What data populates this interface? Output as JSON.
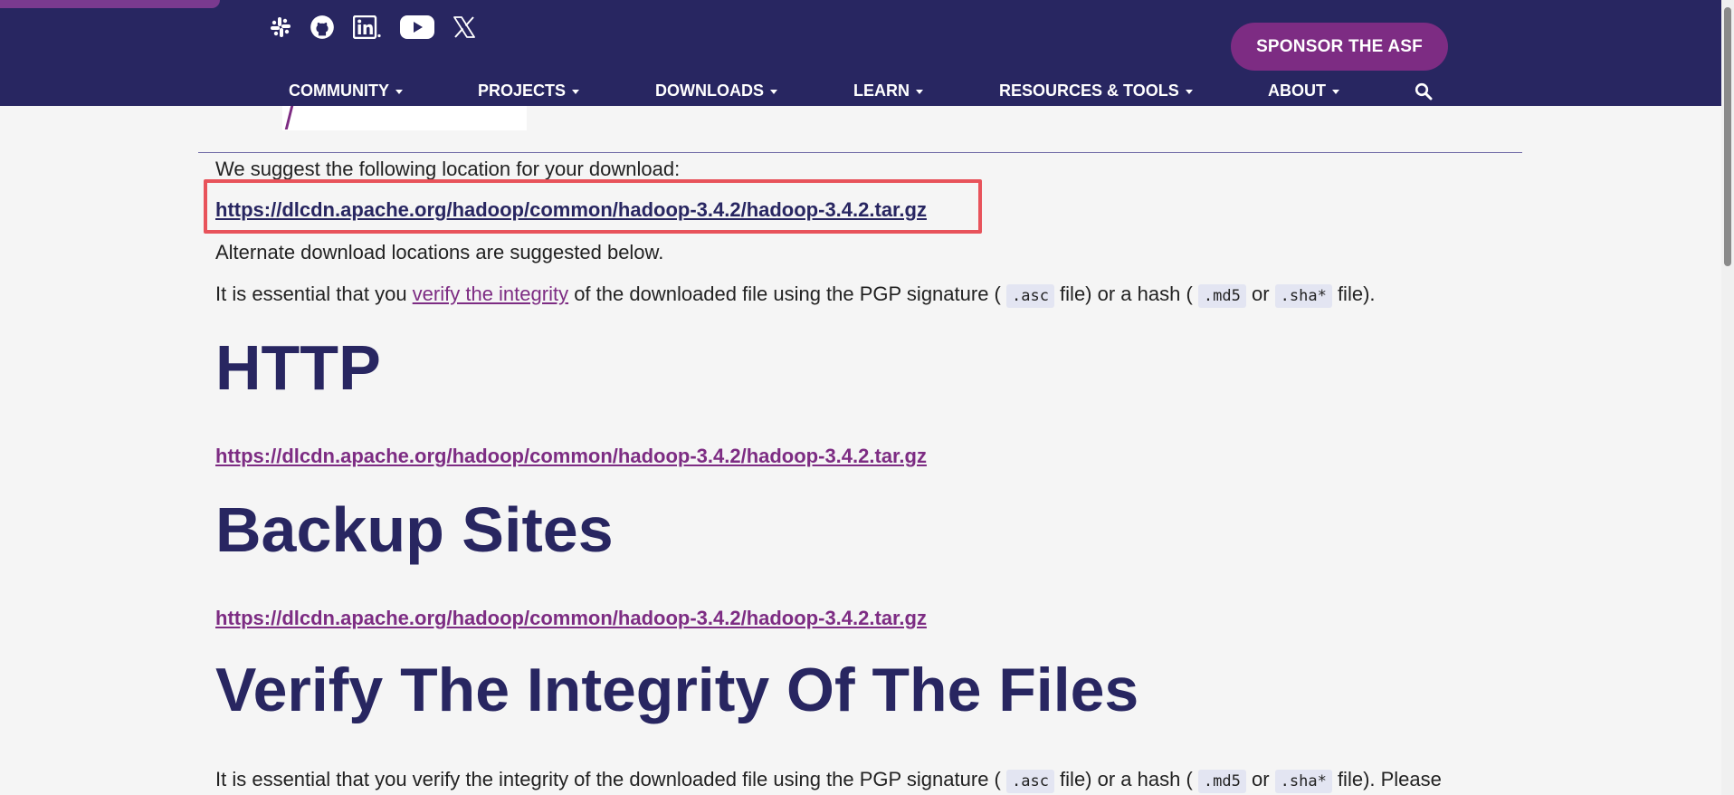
{
  "header": {
    "social_icons": [
      "slack-icon",
      "github-icon",
      "linkedin-icon",
      "youtube-icon",
      "x-icon"
    ],
    "sponsor_label": "SPONSOR THE ASF",
    "nav": [
      {
        "label": "COMMUNITY"
      },
      {
        "label": "PROJECTS"
      },
      {
        "label": "DOWNLOADS"
      },
      {
        "label": "LEARN"
      },
      {
        "label": "RESOURCES & TOOLS"
      },
      {
        "label": "ABOUT"
      }
    ],
    "search_icon": "search-icon"
  },
  "main": {
    "suggest_text": "We suggest the following location for your download:",
    "primary_link": "https://dlcdn.apache.org/hadoop/common/hadoop-3.4.2/hadoop-3.4.2.tar.gz",
    "alternate_text": "Alternate download locations are suggested below.",
    "integrity": {
      "prefix": "It is essential that you ",
      "link": "verify the integrity",
      "middle": " of the downloaded file using the PGP signature ( ",
      "asc": ".asc",
      "hash_text": " file) or a hash ( ",
      "md5": ".md5",
      "or": " or ",
      "sha": ".sha*",
      "suffix": " file)."
    },
    "http_heading": "HTTP",
    "http_link": "https://dlcdn.apache.org/hadoop/common/hadoop-3.4.2/hadoop-3.4.2.tar.gz",
    "backup_heading": "Backup Sites",
    "backup_link": "https://dlcdn.apache.org/hadoop/common/hadoop-3.4.2/hadoop-3.4.2.tar.gz",
    "verify_heading": "Verify The Integrity Of The Files",
    "verify": {
      "prefix": "It is essential that you verify the integrity of the downloaded file using the PGP signature ( ",
      "asc": ".asc",
      "hash_text": " file) or a hash ( ",
      "md5": ".md5",
      "or": " or ",
      "sha": ".sha*",
      "suffix": " file). Please"
    }
  },
  "colors": {
    "header_bg": "#282661",
    "accent_purple": "#7d2c83",
    "highlight_red": "#e8535b",
    "page_bg": "#f5f5f5"
  }
}
